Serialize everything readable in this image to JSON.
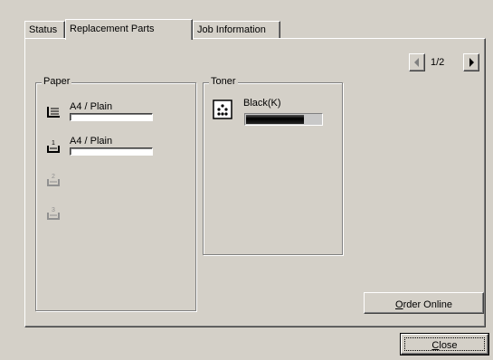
{
  "tabs": [
    {
      "label": "Status"
    },
    {
      "label": "Replacement Parts"
    },
    {
      "label": "Job Information"
    }
  ],
  "nav": {
    "page": "1/2"
  },
  "paper": {
    "title": "Paper",
    "trays": [
      {
        "icon": "paper-tray-icon",
        "label": "A4 / Plain",
        "enabled": true
      },
      {
        "icon": "paper-tray-1-icon",
        "label": "A4 / Plain",
        "enabled": true
      },
      {
        "icon": "paper-tray-2-icon",
        "label": "",
        "enabled": false
      },
      {
        "icon": "paper-tray-3-icon",
        "label": "",
        "enabled": false
      }
    ]
  },
  "toner": {
    "title": "Toner",
    "items": [
      {
        "icon": "toner-icon",
        "label": "Black(K)",
        "level": 0.75
      }
    ]
  },
  "buttons": {
    "order_online": {
      "mnemonic": "O",
      "rest": "rder Online"
    },
    "close": {
      "mnemonic": "C",
      "rest": "lose"
    }
  }
}
